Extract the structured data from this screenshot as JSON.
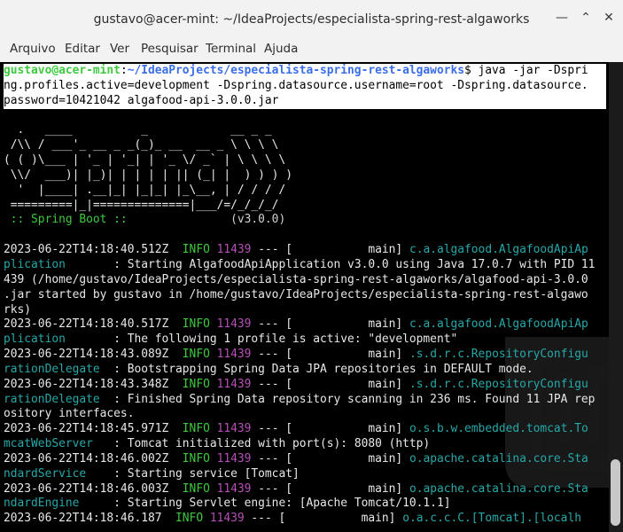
{
  "window": {
    "title": "gustavo@acer-mint: ~/IdeaProjects/especialista-spring-rest-algaworks",
    "minimize_icon": "minimize-icon",
    "maximize_icon": "maximize-icon",
    "close_icon": "close-icon"
  },
  "menu": [
    "Arquivo",
    "Editar",
    "Ver",
    "Pesquisar",
    "Terminal",
    "Ajuda"
  ],
  "prompt": {
    "user": "gustavo@acer-mint",
    "colon": ":",
    "path": "~/IdeaProjects/especialista-spring-rest-algaworks",
    "symbol": "$",
    "command": [
      " java -jar -Dspri",
      "ng.profiles.active=development -Dspring.datasource.username=root -Dspring.datasource.",
      "password=10421042 algafood-api-3.0.0.jar"
    ]
  },
  "banner": [
    "",
    "  .   ____          _            __ _ _",
    " /\\\\ / ___'_ __ _ _(_)_ __  __ _ \\ \\ \\ \\",
    "( ( )\\___ | '_ | '_| | '_ \\/ _` | \\ \\ \\ \\",
    " \\\\/  ___)| |_)| | | | | || (_| |  ) ) ) )",
    "  '  |____| .__|_| |_|_| |_\\__, | / / / /",
    " =========|_|==============|___/=/_/_/_/"
  ],
  "banner_footer": {
    "label": " :: Spring Boot :: ",
    "version": "              (v3.0.0)"
  },
  "log_entries": [
    {
      "ts": "2023-06-22T14:18:40.512Z",
      "level": "INFO",
      "pid": "11439",
      "sep": "---",
      "thread": "[           main]",
      "logger_head": "c.a.algafood.AlgafoodApiAp",
      "logger_tail": "plication      ",
      "msg_first": ": Starting AlgafoodApiApplication v3.0.0 using Java 17.0.7 with PID 11",
      "msg_cont": [
        "439 (/home/gustavo/IdeaProjects/especialista-spring-rest-algaworks/algafood-api-3.0.0",
        ".jar started by gustavo in /home/gustavo/IdeaProjects/especialista-spring-rest-algawo",
        "rks)"
      ]
    },
    {
      "ts": "2023-06-22T14:18:40.517Z",
      "level": "INFO",
      "pid": "11439",
      "sep": "---",
      "thread": "[           main]",
      "logger_head": "c.a.algafood.AlgafoodApiAp",
      "logger_tail": "plication      ",
      "msg_first": ": The following 1 profile is active: \"development\"",
      "msg_cont": []
    },
    {
      "ts": "2023-06-22T14:18:43.089Z",
      "level": "INFO",
      "pid": "11439",
      "sep": "---",
      "thread": "[           main]",
      "logger_head": ".s.d.r.c.RepositoryConfigu",
      "logger_tail": "rationDelegate ",
      "msg_first": ": Bootstrapping Spring Data JPA repositories in DEFAULT mode.",
      "msg_cont": []
    },
    {
      "ts": "2023-06-22T14:18:43.348Z",
      "level": "INFO",
      "pid": "11439",
      "sep": "---",
      "thread": "[           main]",
      "logger_head": ".s.d.r.c.RepositoryConfigu",
      "logger_tail": "rationDelegate ",
      "msg_first": ": Finished Spring Data repository scanning in 236 ms. Found 11 JPA rep",
      "msg_cont": [
        "ository interfaces."
      ]
    },
    {
      "ts": "2023-06-22T14:18:45.971Z",
      "level": "INFO",
      "pid": "11439",
      "sep": "---",
      "thread": "[           main]",
      "logger_head": "o.s.b.w.embedded.tomcat.To",
      "logger_tail": "mcatWebServer  ",
      "msg_first": ": Tomcat initialized with port(s): 8080 (http)",
      "msg_cont": []
    },
    {
      "ts": "2023-06-22T14:18:46.002Z",
      "level": "INFO",
      "pid": "11439",
      "sep": "---",
      "thread": "[           main]",
      "logger_head": "o.apache.catalina.core.Sta",
      "logger_tail": "ndardService   ",
      "msg_first": ": Starting service [Tomcat]",
      "msg_cont": []
    },
    {
      "ts": "2023-06-22T14:18:46.003Z",
      "level": "INFO",
      "pid": "11439",
      "sep": "---",
      "thread": "[           main]",
      "logger_head": "o.apache.catalina.core.Sta",
      "logger_tail": "ndardEngine    ",
      "msg_first": ": Starting Servlet engine: [Apache Tomcat/10.1.1]",
      "msg_cont": []
    },
    {
      "ts": "2023-06-22T14:18:46.187",
      "level": "INFO",
      "pid": "11439",
      "sep": "---",
      "thread": "[           main]",
      "logger_head": "o.a.c.c.C.[Tomcat].[localh",
      "logger_tail": "",
      "msg_first": "",
      "msg_cont": []
    }
  ],
  "colors": {
    "background": "#000000",
    "prompt_user": "#3ec93e",
    "prompt_path": "#3a6ee8",
    "info": "#3ec93e",
    "pid": "#b64fb6",
    "logger": "#27a8a8"
  }
}
